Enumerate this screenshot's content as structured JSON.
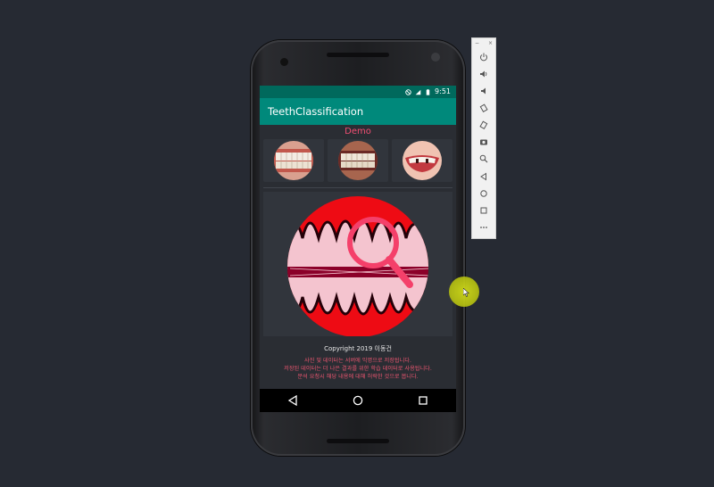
{
  "status_bar": {
    "time": "9:51",
    "icons": [
      "dnd-icon",
      "signal-icon",
      "battery-icon"
    ]
  },
  "app": {
    "title": "TeethClassification"
  },
  "main": {
    "demo_label": "Demo",
    "thumbnails": [
      {
        "name": "teeth-sample-1"
      },
      {
        "name": "teeth-sample-2"
      },
      {
        "name": "teeth-sample-3"
      }
    ],
    "copyright": "Copyright 2019 이동건",
    "notice_lines": [
      "사진 및 데이터는 서버에 익명으로 저장됩니다.",
      "저장된 데이터는 더 나은 결과를 위한 학습 데이터로 사용됩니다.",
      "분석 요청시 해당 내용에 대해 허락한 것으로 봅니다."
    ]
  },
  "navbar": {
    "buttons": [
      "back-icon",
      "home-icon",
      "recents-icon"
    ]
  },
  "emulator_toolbar": {
    "window_controls": [
      "−",
      "×"
    ],
    "buttons": [
      "power-icon",
      "volume-up-icon",
      "volume-down-icon",
      "rotate-left-icon",
      "rotate-right-icon",
      "screenshot-icon",
      "zoom-icon",
      "back-icon",
      "home-icon",
      "overview-icon",
      "more-icon"
    ]
  },
  "colors": {
    "app_bar": "#00897b",
    "status_bar": "#00695c",
    "accent": "#f14f73",
    "logo_red": "#ee0b14"
  }
}
